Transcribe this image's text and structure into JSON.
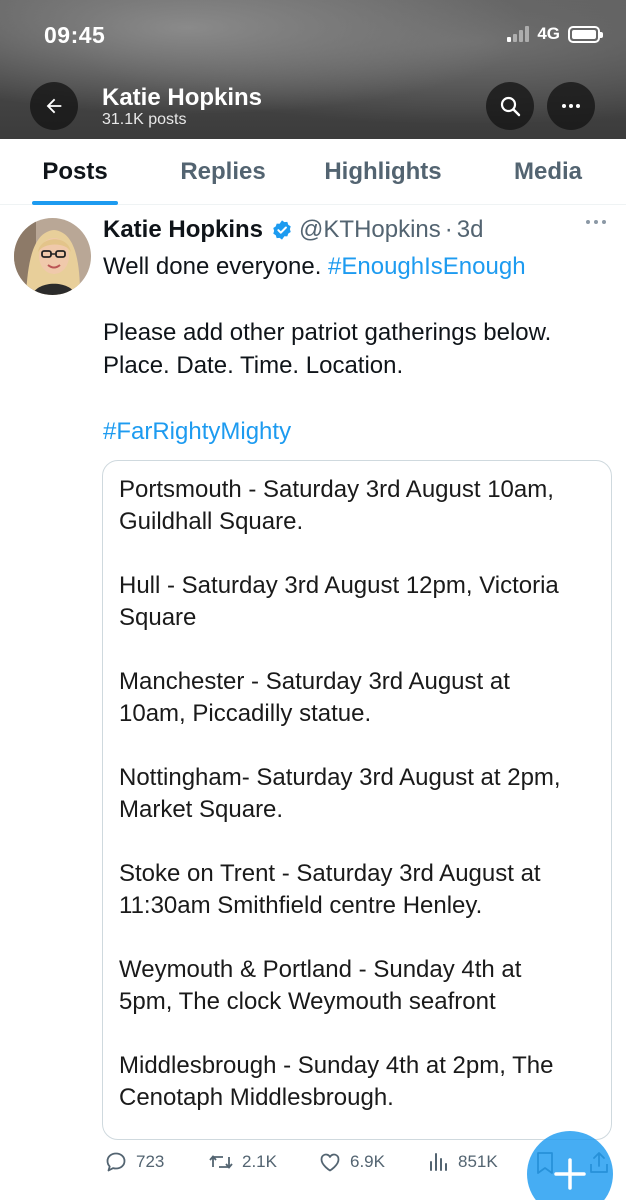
{
  "status_bar": {
    "time": "09:45",
    "network": "4G"
  },
  "header": {
    "name": "Katie Hopkins",
    "post_count": "31.1K posts"
  },
  "tabs": [
    {
      "label": "Posts",
      "active": true
    },
    {
      "label": "Replies",
      "active": false
    },
    {
      "label": "Highlights",
      "active": false
    },
    {
      "label": "Media",
      "active": false
    }
  ],
  "post": {
    "author_name": "Katie Hopkins",
    "handle": "@KTHopkins",
    "separator": "·",
    "time": "3d",
    "line1_text": "Well done everyone. ",
    "line1_hashtag": "#EnoughIsEnough",
    "line2": "Please add other patriot gatherings below.",
    "line3": "Place. Date. Time. Location.",
    "hashtag2": "#FarRightyMighty",
    "embed_lines": [
      "Portsmouth - Saturday 3rd August 10am,",
      "Guildhall Square.",
      "Hull - Saturday 3rd August 12pm, Victoria",
      "Square",
      "Manchester - Saturday 3rd August at",
      "10am, Piccadilly statue.",
      "Nottingham- Saturday 3rd August at 2pm,",
      "Market Square.",
      "Stoke on Trent - Saturday 3rd August at",
      "11:30am Smithfield centre Henley.",
      "Weymouth & Portland - Sunday 4th at",
      "5pm, The clock Weymouth seafront",
      "Middlesbrough - Sunday 4th at 2pm, The",
      "Cenotaph Middlesbrough."
    ],
    "stats": {
      "replies": "723",
      "reposts": "2.1K",
      "likes": "6.9K",
      "views": "851K"
    }
  },
  "colors": {
    "accent": "#1d9bf0",
    "text": "#0f1419",
    "muted": "#536471",
    "border": "#cfd9de"
  },
  "icons": [
    "back-arrow-icon",
    "search-icon",
    "more-icon",
    "verified-badge-icon",
    "reply-icon",
    "repost-icon",
    "like-icon",
    "views-icon",
    "bookmark-icon",
    "share-icon",
    "compose-plus-icon"
  ]
}
